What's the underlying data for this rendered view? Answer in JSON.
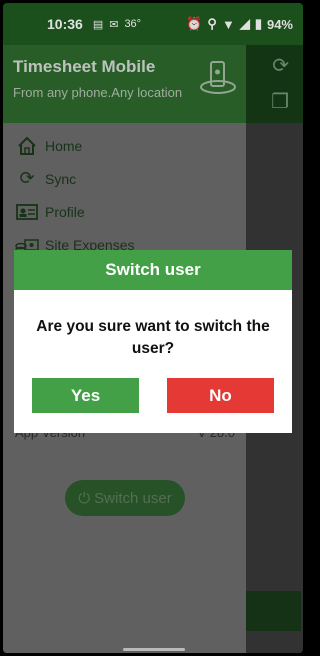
{
  "status_bar": {
    "time": "10:36",
    "temperature": "36°",
    "battery": "94%"
  },
  "drawer": {
    "title": "Timesheet Mobile",
    "subtitle": "From any phone.Any location",
    "menu": [
      {
        "label": "Home",
        "icon": "home-icon"
      },
      {
        "label": "Sync",
        "icon": "sync-icon"
      },
      {
        "label": "Profile",
        "icon": "profile-card-icon"
      },
      {
        "label": "Site Expenses",
        "icon": "money-icon"
      }
    ],
    "version_label": "App Version",
    "version_value": "V 28.0",
    "switch_user_label": "Switch user"
  },
  "dialog": {
    "title": "Switch user",
    "message": "Are you sure want to switch the user?",
    "yes_label": "Yes",
    "no_label": "No"
  },
  "colors": {
    "dialog_header": "#43a047",
    "yes_button": "#43a047",
    "no_button": "#e53935",
    "drawer_header": "#2e6a2e"
  }
}
